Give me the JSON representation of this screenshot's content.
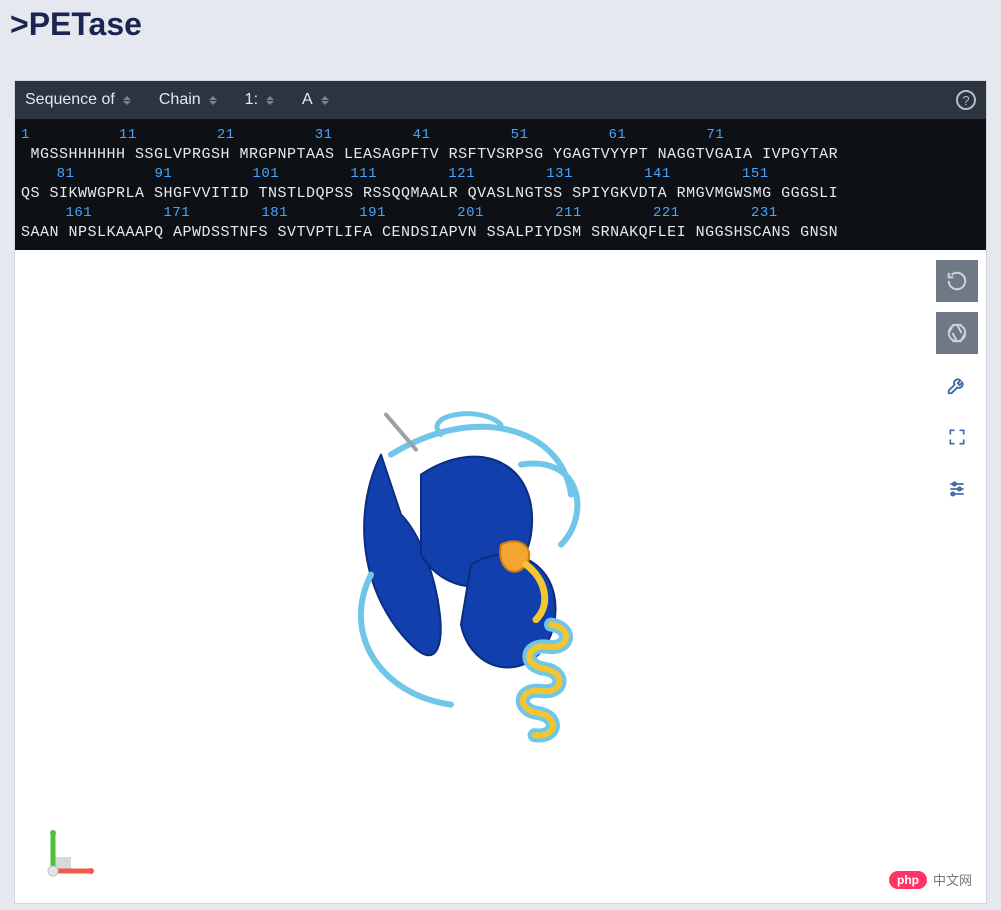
{
  "title": ">PETase",
  "toolbar": {
    "label_sequence": "Sequence of",
    "label_chain": "Chain",
    "label_model": "1:",
    "label_chainid": "A"
  },
  "sequence": {
    "ruler1": [
      1,
      11,
      21,
      31,
      41,
      51,
      61,
      71
    ],
    "line1": [
      "MGSSHHHHHH",
      "SSGLVPRGSH",
      "MRGPNPTAAS",
      "LEASAGPFTV",
      "RSFTVSRPSG",
      "YGAGTVYYPT",
      "NAGGTVGAIA",
      "IVPGYTAR"
    ],
    "ruler2": [
      81,
      91,
      101,
      111,
      121,
      131,
      141,
      151
    ],
    "line2": [
      "QS SIKWWGPRLA",
      "SHGFVVITID",
      "TNSTLDQPSS",
      "RSSQQMAALR",
      "QVASLNGTSS",
      "SPIYGKVDTA",
      "RMGVMGWSMG",
      "GGGSLI"
    ],
    "ruler3": [
      161,
      171,
      181,
      191,
      201,
      211,
      221,
      231
    ],
    "line3": [
      "SAAN NPSLKAAAPQ",
      "APWDSSTNFS",
      "SVTVPTLIFA",
      "CENDSIAPVN",
      "SSALPIYDSM",
      "SRNAKQFLEI",
      "NGGSHSCANS",
      "GNSN"
    ]
  },
  "watermark": {
    "bubble": "php",
    "text": "中文网"
  },
  "icons": {
    "help": "?",
    "reload": "↻",
    "target": "⊛",
    "wrench": "wrench",
    "expand": "expand",
    "sliders": "sliders"
  }
}
